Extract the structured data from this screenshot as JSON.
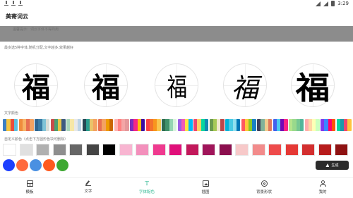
{
  "status_bar": {
    "time": "3:29",
    "left_icons": [
      "download-icon",
      "download-icon",
      "download-icon"
    ],
    "right_icons": [
      "location-icon",
      "wifi-icon",
      "signal-icon",
      "battery-icon"
    ]
  },
  "app": {
    "title": "美寄词云"
  },
  "backdrop": {
    "hint": "温馨提示：词云字体不得商用"
  },
  "font_section": {
    "label": "最多选5种字体,随机分配,文字越多,效果越好",
    "glyph": "福",
    "fonts": [
      "bold-sans",
      "bold-serif",
      "thin-serif",
      "calligraphy",
      "heavy-black"
    ]
  },
  "palette_section": {
    "label": "文字颜色",
    "palettes": [
      [
        "#3b7fc4",
        "#f4c542",
        "#e94e3c",
        "#5bc0de"
      ],
      [
        "#f08c3c",
        "#f7b267",
        "#e76f51",
        "#f4a261"
      ],
      [
        "#2f6690",
        "#3a7ca5",
        "#81c3d7",
        "#d9dcd6"
      ],
      [
        "#c94c4c",
        "#4c9f70",
        "#e8c547",
        "#3d5a80"
      ],
      [
        "#a8d5ba",
        "#f6e7a6",
        "#e8e8e8",
        "#bcd4e6"
      ],
      [
        "#264653",
        "#2a9d8f",
        "#e9c46a",
        "#f4a261"
      ],
      [
        "#e76f51",
        "#f4a261",
        "#ee9b00",
        "#ca6702"
      ],
      [
        "#ffb3b3",
        "#ff8080",
        "#f4a6a6",
        "#e5989b"
      ],
      [
        "#7b2cbf",
        "#f72585",
        "#ffbe0b",
        "#3a0ca3"
      ],
      [
        "#f94144",
        "#f3722c",
        "#f8961e",
        "#f9c74f"
      ],
      [
        "#2d6a4f",
        "#40916c",
        "#95d5b2",
        "#d8f3dc"
      ],
      [
        "#9b5de5",
        "#f15bb5",
        "#fee440",
        "#00bbf9"
      ],
      [
        "#ef476f",
        "#ffd166",
        "#06d6a0",
        "#118ab2"
      ],
      [
        "#6a994e",
        "#a7c957",
        "#f2e8cf",
        "#bc4749"
      ],
      [
        "#00b4d8",
        "#48cae4",
        "#90e0ef",
        "#0077b6"
      ],
      [
        "#ff595e",
        "#ffca3a",
        "#8ac926",
        "#1982c4"
      ],
      [
        "#3d405b",
        "#81b29a",
        "#f2cc8f",
        "#e07a5f"
      ],
      [
        "#4361ee",
        "#4cc9f0",
        "#7209b7",
        "#f72585"
      ],
      [
        "#b5e48c",
        "#99d98c",
        "#76c893",
        "#52b69a"
      ],
      [
        "#ffadad",
        "#ffd6a5",
        "#fdffb6",
        "#caffbf"
      ],
      [
        "#8338ec",
        "#3a86ff",
        "#ff006e",
        "#fb5607"
      ],
      [
        "#06d6a0",
        "#1b9aaa",
        "#ef476f",
        "#ffc43d"
      ]
    ]
  },
  "custom_section": {
    "label": "自定义颜色（点击下方圆形色块可删除）",
    "swatches": [
      "#ffffff",
      "#e0e0e0",
      "#b0b0b0",
      "#8e8e8e",
      "#666666",
      "#444444",
      "#000000",
      "#f8b5d1",
      "#f390bc",
      "#ef3a8f",
      "#e0107a",
      "#c2185b",
      "#a0155a",
      "#8b0f4e",
      "#f7c9c9",
      "#f28b8b",
      "#ee4b4b",
      "#e53935",
      "#d32f2f",
      "#b71c1c",
      "#8e1212"
    ],
    "selected_colors": [
      "#1e40ff",
      "#ff6a3d",
      "#4a90e2",
      "#ff5a1f",
      "#3ea832"
    ]
  },
  "generate_button": {
    "label": "生成",
    "icon": "send-icon"
  },
  "bottom_nav": {
    "items": [
      {
        "label": "模板",
        "icon": "template-icon",
        "active": false
      },
      {
        "label": "文字",
        "icon": "pen-icon",
        "active": false
      },
      {
        "label": "字体配色",
        "icon": "text-format-icon",
        "active": true
      },
      {
        "label": "插图",
        "icon": "image-icon",
        "active": false
      },
      {
        "label": "背景形状",
        "icon": "shape-icon",
        "active": false
      },
      {
        "label": "我的",
        "icon": "user-icon",
        "active": false
      }
    ]
  }
}
